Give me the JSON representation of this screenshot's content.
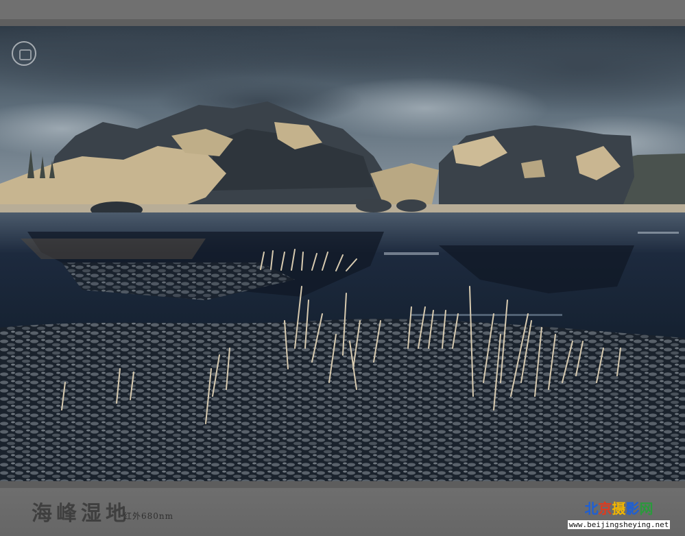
{
  "caption": {
    "title": "海峰湿地",
    "subtitle": "红外680nm"
  },
  "brand": {
    "chars": [
      "北",
      "京",
      "摄",
      "影",
      "网"
    ],
    "url": "www.beijingsheying.net",
    "colors": [
      "#1d5fd6",
      "#e03a1e",
      "#f2b600",
      "#1d5fd6",
      "#2a9a3c"
    ]
  },
  "photo": {
    "subject": "infrared landscape photograph of a wetland with karst rock outcrops, stormy sky, reflecting water and reeds",
    "palette": {
      "sky": "#5a6a78",
      "rock": "#3c444c",
      "foliage": "#cbb894",
      "water": "#202a3a",
      "lilypads": "#3a4048"
    }
  }
}
